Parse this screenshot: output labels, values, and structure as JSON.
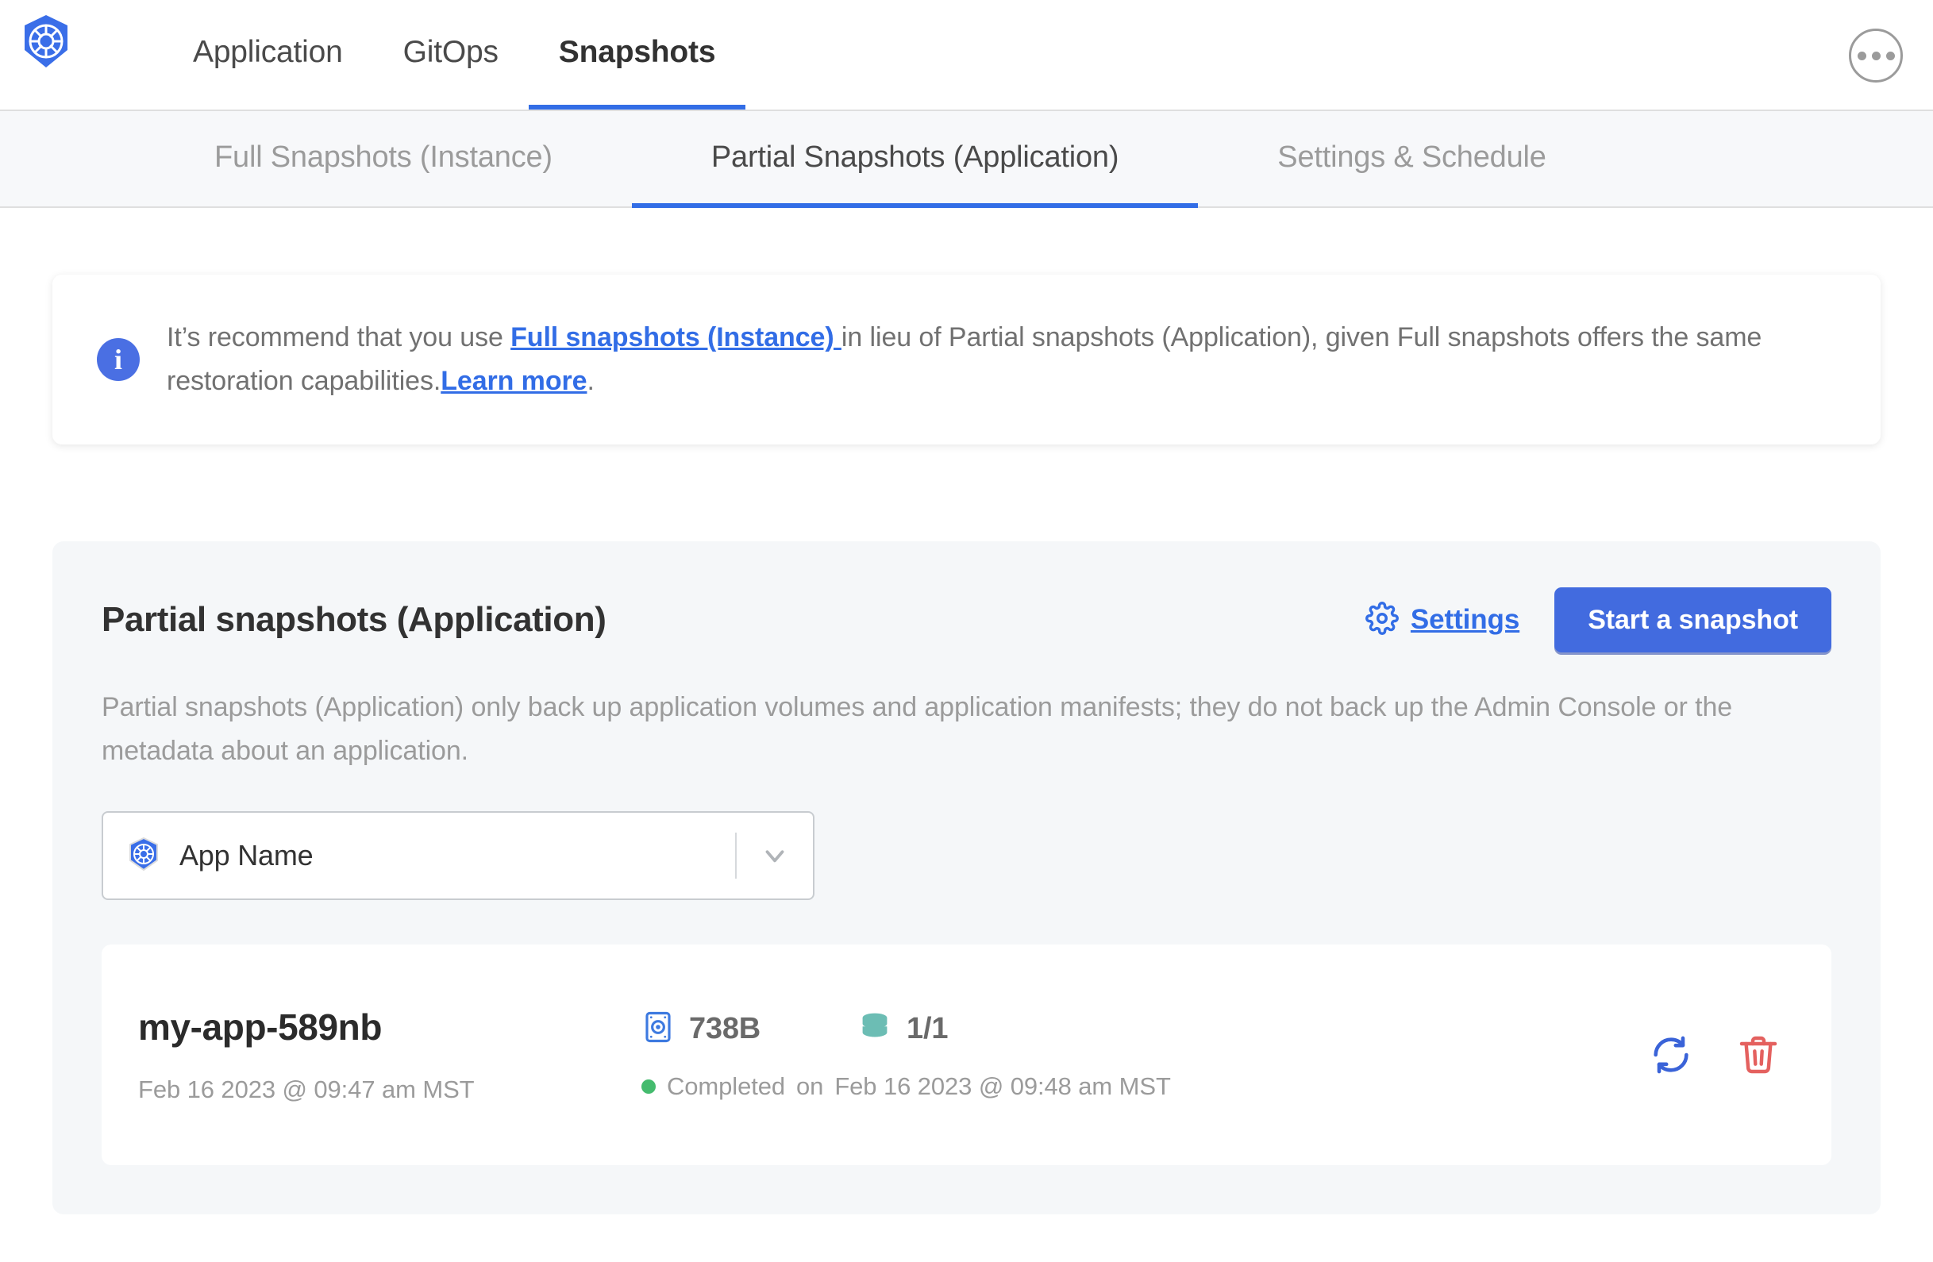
{
  "header": {
    "logo_icon": "kubernetes-logo-icon",
    "nav": [
      {
        "label": "Application",
        "active": false
      },
      {
        "label": "GitOps",
        "active": false
      },
      {
        "label": "Snapshots",
        "active": true
      }
    ],
    "menu_icon": "ellipsis-circle-icon"
  },
  "subnav": {
    "items": [
      {
        "label": "Full Snapshots (Instance)",
        "active": false
      },
      {
        "label": "Partial Snapshots (Application)",
        "active": true
      },
      {
        "label": "Settings & Schedule",
        "active": false
      }
    ]
  },
  "banner": {
    "icon": "info-icon",
    "text_part1": "It’s recommend that you use ",
    "link1": "Full snapshots (Instance) ",
    "text_part2": "in lieu of Partial snapshots (Application), given Full snapshots offers the same restoration capabilities.",
    "link2": "Learn more",
    "text_part3": "."
  },
  "card": {
    "title": "Partial snapshots (Application)",
    "settings_label": "Settings",
    "settings_icon": "gear-icon",
    "start_button_label": "Start a snapshot",
    "description": "Partial snapshots (Application) only back up application volumes and application manifests; they do not back up the Admin Console or the metadata about an application."
  },
  "app_select": {
    "icon": "kubernetes-logo-icon",
    "value": "App Name",
    "caret_icon": "chevron-down-icon"
  },
  "snapshot": {
    "name": "my-app-589nb",
    "started_at": "Feb 16 2023 @ 09:47 am MST",
    "size_icon": "disk-icon",
    "size": "738B",
    "volumes_icon": "database-icon",
    "volumes": "1/1",
    "status": "Completed",
    "status_preposition": "on",
    "finished_at": "Feb 16 2023 @ 09:48 am MST",
    "restore_icon": "restore-refresh-icon",
    "delete_icon": "trash-icon"
  },
  "colors": {
    "accent_blue": "#326de6",
    "button_blue": "#426bdf",
    "status_green": "#44bb6e",
    "delete_red": "#e4615f",
    "database_teal": "#6cbdb4",
    "muted_gray": "#9b9b9b"
  }
}
